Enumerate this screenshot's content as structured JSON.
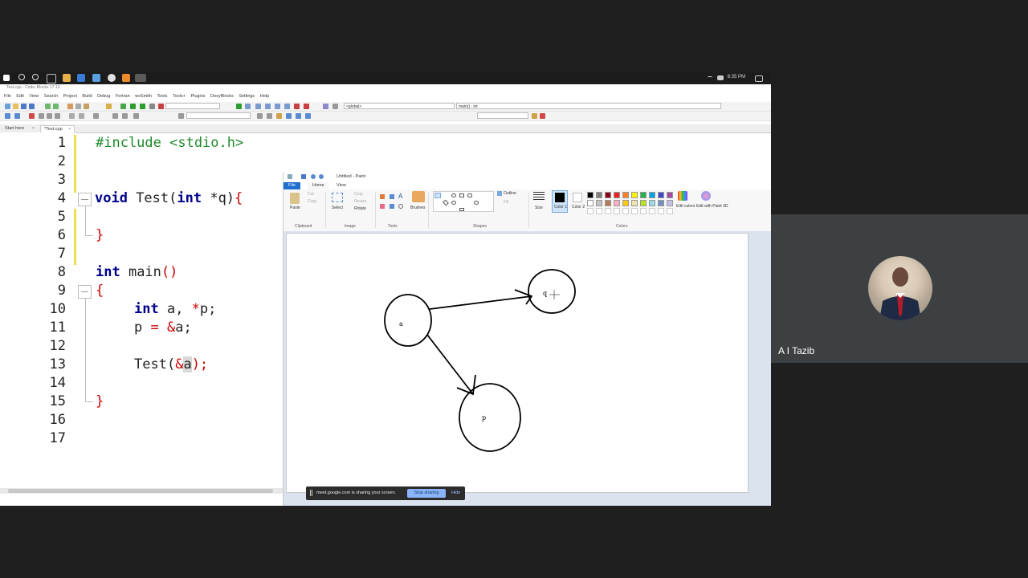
{
  "taskbar": {
    "time": "8:35 PM"
  },
  "codeblocks": {
    "title": "Test.cpp - Code::Blocks 17.12",
    "menu": [
      "File",
      "Edit",
      "View",
      "Search",
      "Project",
      "Build",
      "Debug",
      "Fortran",
      "wxSmith",
      "Tools",
      "Tools+",
      "Plugins",
      "DoxyBlocks",
      "Settings",
      "Help"
    ],
    "scope_combo": "<global>",
    "function_combo": "main() : int",
    "tabs": [
      "Start here",
      "*Test.cpp"
    ],
    "line_numbers": [
      "1",
      "2",
      "3",
      "4",
      "5",
      "6",
      "7",
      "8",
      "9",
      "10",
      "11",
      "12",
      "13",
      "14",
      "15",
      "16",
      "17"
    ],
    "code": {
      "l1": "#include <stdio.h>",
      "l4_kw": "void",
      "l4_name": " Test(",
      "l4_kw2": "int",
      "l4_rest": " *q)",
      "l4_brace": "{",
      "l6_brace": "}",
      "l8_kw": "int",
      "l8_rest": " main",
      "l8_paren": "()",
      "l9_brace": "{",
      "l10_kw": "int",
      "l10_rest": " a, ",
      "l10_star": "*",
      "l10_rest2": "p;",
      "l11_a": "p ",
      "l11_eq": "=",
      "l11_b": " ",
      "l11_amp": "&",
      "l11_c": "a;",
      "l13_a": "Test(",
      "l13_amp": "&",
      "l13_hl": "a",
      "l13_end": ");",
      "l15_brace": "}"
    }
  },
  "paint": {
    "title": "Untitled - Paint",
    "tabs": {
      "file": "File",
      "home": "Home",
      "view": "View"
    },
    "groups": {
      "clipboard": "Clipboard",
      "image": "Image",
      "tools": "Tools",
      "shapes": "Shapes",
      "colors": "Colors"
    },
    "labels": {
      "paste": "Paste",
      "cut": "Cut",
      "copy": "Copy",
      "select": "Select",
      "crop": "Crop",
      "resize": "Resize",
      "rotate": "Rotate",
      "brushes": "Brushes",
      "outline": "Outline",
      "fill": "Fill",
      "size": "Size",
      "color1": "Color 1",
      "color2": "Color 2",
      "edit_colors": "Edit colors",
      "edit_paint3d": "Edit with Paint 3D"
    },
    "palette": [
      "#000000",
      "#7f7f7f",
      "#880015",
      "#ed1c24",
      "#ff7f27",
      "#fff200",
      "#22b14c",
      "#00a2e8",
      "#3f48cc",
      "#a349a4",
      "#ffffff",
      "#c3c3c3",
      "#b97a57",
      "#ffaec9",
      "#ffc90e",
      "#efe4b0",
      "#b5e61d",
      "#99d9ea",
      "#7092be",
      "#c8bfe7"
    ],
    "nodes": {
      "a": "a",
      "q": "q",
      "p": "p"
    }
  },
  "share_bar": {
    "text": "meet.google.com is sharing your screen.",
    "stop": "Stop sharing",
    "hide": "Hide"
  },
  "meet": {
    "participant": "A I Tazib"
  }
}
